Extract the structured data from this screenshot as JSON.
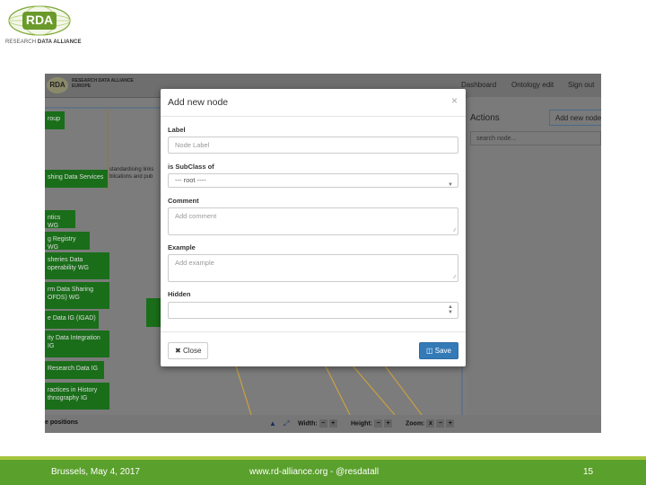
{
  "branding": {
    "logo_text": "RDA",
    "logo_subtitle_1": "RESEARCH",
    "logo_subtitle_2": "DATA ALLIANCE"
  },
  "app": {
    "mini_logo": "RDA",
    "brand_line1": "RESEARCH DATA ALLIANCE",
    "brand_line2": "EUROPE",
    "nav": {
      "dashboard": "Dashboard",
      "ontology_edit": "Ontology edit",
      "sign_out": "Sign out"
    },
    "nodes": [
      "roup",
      "shing Data Services",
      "ntics WG",
      "g Registry WG",
      "sheries Data",
      "operability WG",
      "rm Data Sharing",
      "OFDS) WG",
      "e Data IG (IGAD)",
      "ity Data Integration",
      "IG",
      " Research Data IG",
      "ractices in History",
      "thnography IG"
    ],
    "side_text_1": "standardising links",
    "side_text_2": "blications and pub",
    "actions_title": "Actions",
    "add_node_button": "Add new node",
    "search_placeholder": "search node...",
    "bottom": {
      "positions": "e positions",
      "width": "Width:",
      "height": "Height:",
      "zoom": "Zoom:",
      "minus": "−",
      "plus": "+",
      "x": "x"
    }
  },
  "modal": {
    "title": "Add new node",
    "close_symbol": "×",
    "label_label": "Label",
    "label_placeholder": "Node Label",
    "subclass_label": "is SubClass of",
    "subclass_value": "--- root ----",
    "comment_label": "Comment",
    "comment_placeholder": "Add comment",
    "example_label": "Example",
    "example_placeholder": "Add example",
    "hidden_label": "Hidden",
    "hidden_value": "",
    "close_button": "Close",
    "save_button": "Save",
    "save_color": "#337ab7"
  },
  "footer": {
    "location_date": "Brussels, May 4, 2017",
    "website": "www.rd-alliance.org - @resdatall",
    "page_number": "15",
    "band_color": "#5aa02c"
  }
}
